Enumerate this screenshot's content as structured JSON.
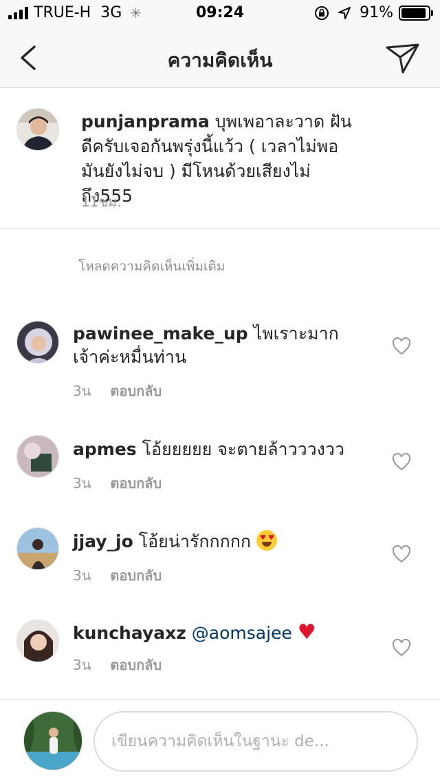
{
  "status_bar": {
    "carrier": "TRUE-H",
    "network": "3G",
    "time": "09:24",
    "battery": "91%",
    "battery_level": 0.91
  },
  "header": {
    "title": "ความคิดเห็น"
  },
  "caption": {
    "username": "punjanprama",
    "text": "บุพเพอาละวาด ฝันดีครับเจอกันพรุ่งนี้แว้ว ( เวลาไม่พอมันยังไม่จบ ) มีโหนด้วยเสียงไม่ถึง555",
    "time": "11ชม."
  },
  "load_more": "โหลดความคิดเห็นเพิ่มเติม",
  "comments": [
    {
      "username": "pawinee_make_up",
      "text": "ไพเราะมากเจ้าค่ะหมื่นท่าน",
      "time": "3น",
      "reply_label": "ตอบกลับ"
    },
    {
      "username": "apmes",
      "text": "โอ้ยยยยย จะตายล้าวววงวว",
      "time": "3น",
      "reply_label": "ตอบกลับ"
    },
    {
      "username": "jjay_jo",
      "text": "โอ้ยน่ารักกกกก",
      "time": "3น",
      "reply_label": "ตอบกลับ"
    },
    {
      "username": "kunchayaxz",
      "mention": "@aomsajee",
      "time": "3น",
      "reply_label": "ตอบกลับ"
    }
  ],
  "input": {
    "placeholder": "เขียนความคิดเห็นในฐานะ de..."
  },
  "colors": {
    "mention": "#003569",
    "heart": "#e0142a",
    "secondary_text": "#999999",
    "divider": "#dbdbdb"
  }
}
